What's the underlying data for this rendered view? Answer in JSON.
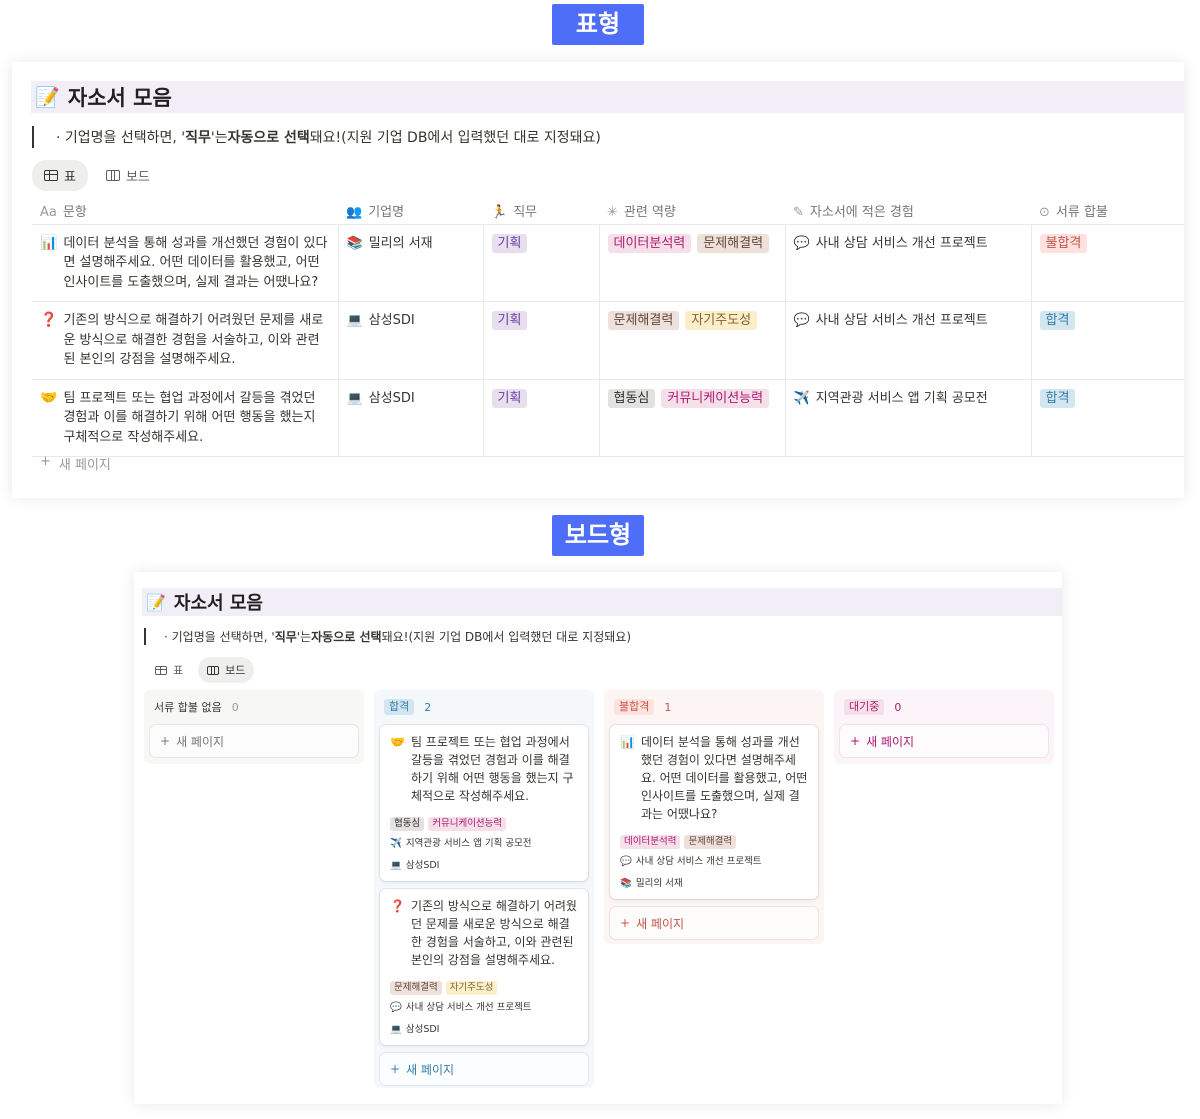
{
  "labels": {
    "table_view": "표형",
    "board_view": "보드형"
  },
  "database": {
    "icon": "📝",
    "title": "자소서 모음",
    "callout": {
      "prefix": "· 기업명을 선택하면, '",
      "bold1": "직무",
      "middle": "'는 ",
      "bold2": "자동으로 선택",
      "suffix": "돼요!(지원 기업 DB에서 입력했던 대로 지정돼요)"
    },
    "views": {
      "table": "표",
      "board": "보드"
    }
  },
  "table": {
    "columns": {
      "question": {
        "icon": "Aa",
        "label": "문항"
      },
      "company": {
        "icon": "👥",
        "label": "기업명"
      },
      "role": {
        "icon": "🏃",
        "label": "직무"
      },
      "skills": {
        "icon": "✳",
        "label": "관련 역량"
      },
      "experience": {
        "icon": "✎",
        "label": "자소서에 적은 경험"
      },
      "result": {
        "icon": "⊙",
        "label": "서류 합불"
      }
    },
    "rows": [
      {
        "q_icon": "📊",
        "question": "데이터 분석을 통해 성과를 개선했던 경험이 있다면 설명해주세요. 어떤 데이터를 활용했고, 어떤 인사이트를 도출했으며, 실제 결과는 어땠나요?",
        "company_icon": "📚",
        "company": "밀리의 서재",
        "role": "기획",
        "skills": [
          "데이터분석력",
          "문제해결력"
        ],
        "exp_icon": "💬",
        "experience": "사내 상담 서비스 개선 프로젝트",
        "result": "불합격"
      },
      {
        "q_icon": "❓",
        "question": "기존의 방식으로 해결하기 어려웠던 문제를 새로운 방식으로 해결한 경험을 서술하고, 이와 관련된 본인의 강점을 설명해주세요.",
        "company_icon": "💻",
        "company": "삼성SDI",
        "role": "기획",
        "skills": [
          "문제해결력",
          "자기주도성"
        ],
        "exp_icon": "💬",
        "experience": "사내 상담 서비스 개선 프로젝트",
        "result": "합격"
      },
      {
        "q_icon": "🤝",
        "question": "팀 프로젝트 또는 협업 과정에서 갈등을 겪었던 경험과 이를 해결하기 위해 어떤 행동을 했는지 구체적으로 작성해주세요.",
        "company_icon": "💻",
        "company": "삼성SDI",
        "role": "기획",
        "skills": [
          "협동심",
          "커뮤니케이션능력"
        ],
        "exp_icon": "✈️",
        "experience": "지역관광 서비스 앱 기획 공모전",
        "result": "합격"
      }
    ],
    "new_page": "새 페이지"
  },
  "board": {
    "columns": [
      {
        "label": "서류 합불 없음",
        "count": "0",
        "new_page": "새 페이지"
      },
      {
        "label": "합격",
        "count": "2",
        "new_page": "새 페이지"
      },
      {
        "label": "불합격",
        "count": "1",
        "new_page": "새 페이지"
      },
      {
        "label": "대기중",
        "count": "0",
        "new_page": "새 페이지"
      }
    ],
    "cards": {
      "pass1": {
        "q_icon": "🤝",
        "question": "팀 프로젝트 또는 협업 과정에서 갈등을 겪었던 경험과 이를 해결하기 위해 어떤 행동을 했는지 구체적으로 작성해주세요.",
        "skills": [
          "협동심",
          "커뮤니케이션능력"
        ],
        "exp_icon": "✈️",
        "experience": "지역관광 서비스 앱 기획 공모전",
        "company_icon": "💻",
        "company": "삼성SDI"
      },
      "pass2": {
        "q_icon": "❓",
        "question": "기존의 방식으로 해결하기 어려웠던 문제를 새로운 방식으로 해결한 경험을 서술하고, 이와 관련된 본인의 강점을 설명해주세요.",
        "skills": [
          "문제해결력",
          "자기주도성"
        ],
        "exp_icon": "💬",
        "experience": "사내 상담 서비스 개선 프로젝트",
        "company_icon": "💻",
        "company": "삼성SDI"
      },
      "fail1": {
        "q_icon": "📊",
        "question": "데이터 분석을 통해 성과를 개선했던 경험이 있다면 설명해주세요. 어떤 데이터를 활용했고, 어떤 인사이트를 도출했으며, 실제 결과는 어땠나요?",
        "skills": [
          "데이터분석력",
          "문제해결력"
        ],
        "exp_icon": "💬",
        "experience": "사내 상담 서비스 개선 프로젝트",
        "company_icon": "📚",
        "company": "밀리의 서재"
      }
    }
  },
  "colors": {
    "label_bg": "#4f6ef7",
    "title_bg": "#f1eef8"
  }
}
